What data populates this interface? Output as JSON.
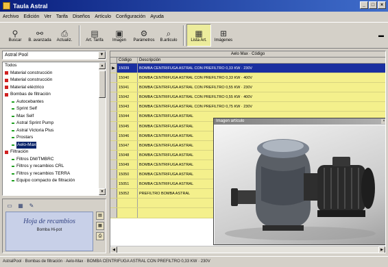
{
  "window": {
    "title": "Taula Astral",
    "controls": [
      "_",
      "□",
      "×"
    ]
  },
  "menu": [
    "Archivo",
    "Edición",
    "Ver",
    "Tarifa",
    "Diseños",
    "Artículo",
    "Configuración",
    "Ayuda"
  ],
  "toolbar": [
    {
      "label": "Buscar",
      "icon": "binoculars-icon"
    },
    {
      "label": "B. avanzada",
      "icon": "advanced-search-icon"
    },
    {
      "label": "Actualiz.",
      "icon": "update-icon"
    },
    {
      "label": "Art. Tarifa",
      "icon": "price-list-icon"
    },
    {
      "label": "Imagen",
      "icon": "image-icon"
    },
    {
      "label": "Parámetros",
      "icon": "parameters-icon"
    },
    {
      "label": "B.articulo",
      "icon": "article-search-icon"
    },
    {
      "label": "Lista Art.",
      "icon": "article-list-icon",
      "active": true
    },
    {
      "label": "Imágenes",
      "icon": "images-icon"
    }
  ],
  "sidebar": {
    "combo_value": "Astral Pool",
    "tree": [
      {
        "label": "Todos",
        "level": 0,
        "bullet": "none"
      },
      {
        "label": "Material construcción",
        "level": 0,
        "bullet": "red"
      },
      {
        "label": "Material construcción",
        "level": 0,
        "bullet": "red"
      },
      {
        "label": "Material eléctrico",
        "level": 0,
        "bullet": "red"
      },
      {
        "label": "Bombas de filtración",
        "level": 0,
        "bullet": "red"
      },
      {
        "label": "Autocebantes",
        "level": 1,
        "bullet": "green"
      },
      {
        "label": "Sprint Self",
        "level": 1,
        "bullet": "green"
      },
      {
        "label": "Max Self",
        "level": 1,
        "bullet": "green"
      },
      {
        "label": "Astral Sprint Pump",
        "level": 1,
        "bullet": "green"
      },
      {
        "label": "Astral Victoria Plus",
        "level": 1,
        "bullet": "green"
      },
      {
        "label": "Prostars",
        "level": 1,
        "bullet": "green"
      },
      {
        "label": "Aelo-Max",
        "level": 1,
        "bullet": "green",
        "selected": true
      },
      {
        "label": "Filtración",
        "level": 0,
        "bullet": "red"
      },
      {
        "label": "Filtros DM/TMBRC",
        "level": 1,
        "bullet": "green"
      },
      {
        "label": "Filtros y recambios CRL",
        "level": 1,
        "bullet": "green"
      },
      {
        "label": "Filtros y recambios TERRA",
        "level": 1,
        "bullet": "green"
      },
      {
        "label": "Equipo compacto de filtración",
        "level": 1,
        "bullet": "green"
      }
    ],
    "bottom_title": "Hoja de recambios",
    "bottom_sub": "Bomba Hi-pot",
    "bottom_tabs": [
      "tab-view-icon",
      "tab-grid-icon",
      "tab-tool-icon"
    ],
    "bottom_side": [
      "pdf-icon",
      "table-icon",
      "print-icon"
    ]
  },
  "table": {
    "caption": "Aelo Max · Código",
    "columns": [
      "Código",
      "Descripción"
    ],
    "rows": [
      {
        "code": "15039",
        "desc": "BOMBA CENTRIFUGA ASTRAL CON PREFILTRO 0,33 KW · 230V",
        "selected": true
      },
      {
        "code": "15040",
        "desc": "BOMBA CENTRIFUGA ASTRAL CON PREFILTRO 0,33 KW · 400V"
      },
      {
        "code": "15041",
        "desc": "BOMBA CENTRIFUGA ASTRAL CON PREFILTRO 0,55 KW · 230V"
      },
      {
        "code": "15042",
        "desc": "BOMBA CENTRIFUGA ASTRAL CON PREFILTRO 0,55 KW · 400V"
      },
      {
        "code": "15043",
        "desc": "BOMBA CENTRIFUGA ASTRAL CON PREFILTRO 0,75 KW · 230V"
      },
      {
        "code": "15044",
        "desc": "BOMBA CENTRIFUGA ASTRAL"
      },
      {
        "code": "15045",
        "desc": "BOMBA CENTRIFUGA ASTRAL"
      },
      {
        "code": "15046",
        "desc": "BOMBA CENTRIFUGA ASTRAL"
      },
      {
        "code": "15047",
        "desc": "BOMBA CENTRIFUGA ASTRAL"
      },
      {
        "code": "15048",
        "desc": "BOMBA CENTRIFUGA ASTRAL"
      },
      {
        "code": "15049",
        "desc": "BOMBA CENTRIFUGA ASTRAL"
      },
      {
        "code": "15050",
        "desc": "BOMBA CENTRIFUGA ASTRAL"
      },
      {
        "code": "15051",
        "desc": "BOMBA CENTRIFUGA ASTRAL"
      },
      {
        "code": "15052",
        "desc": "PREFILTRO BOMBA ASTRAL"
      },
      {
        "code": "",
        "desc": ""
      },
      {
        "code": "",
        "desc": ""
      }
    ]
  },
  "preview": {
    "title": "Imagen artículo"
  },
  "status": {
    "text": "AstralPool · Bombas de filtración · Aelo-Max · BOMBA CENTRIFUGA ASTRAL CON PREFILTRO 0,33 KW · 230V"
  }
}
